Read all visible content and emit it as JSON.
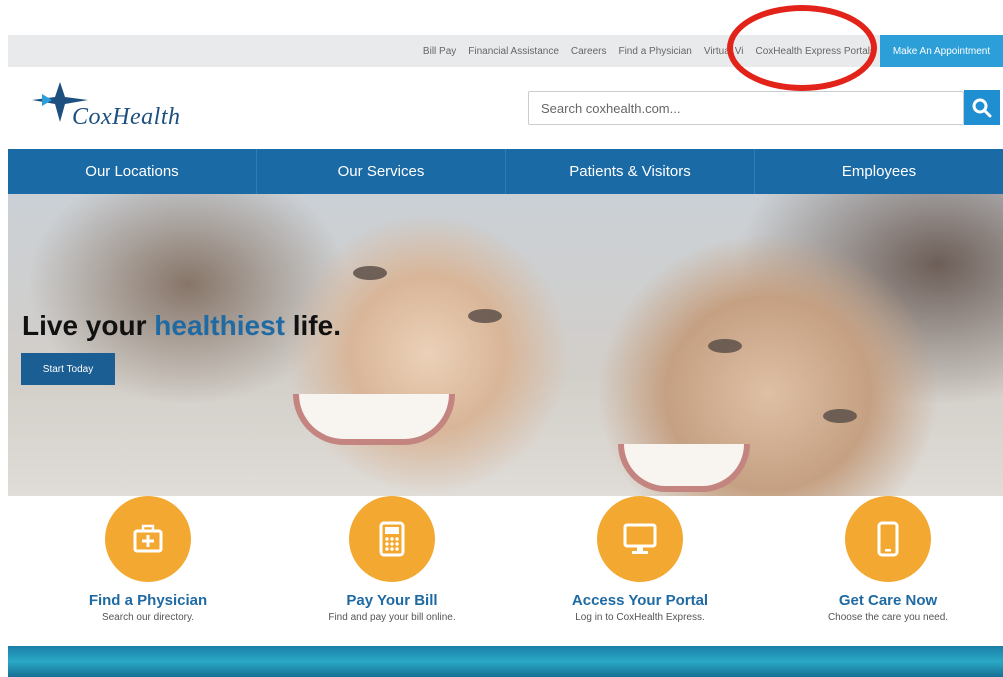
{
  "utility": {
    "links": [
      "Bill Pay",
      "Financial Assistance",
      "Careers",
      "Find a Physician",
      "Virtual Vi",
      "CoxHealth Express Portals"
    ],
    "appointment_label": "Make An Appointment",
    "accent_color": "#2c9fd9",
    "highlight_color": "#e2231a"
  },
  "header": {
    "logo_text": "CoxHealth",
    "search_placeholder": "Search coxhealth.com...",
    "search_icon": "search-icon"
  },
  "nav": {
    "items": [
      "Our Locations",
      "Our Services",
      "Patients & Visitors",
      "Employees"
    ],
    "color": "#1a6aa5"
  },
  "hero": {
    "headline_pre": "Live your ",
    "headline_accent": "healthiest",
    "headline_post": " life.",
    "cta_label": "Start Today"
  },
  "tiles": [
    {
      "icon": "medical-kit-icon",
      "title": "Find a Physician",
      "subtitle": "Search our directory."
    },
    {
      "icon": "calculator-icon",
      "title": "Pay Your Bill",
      "subtitle": "Find and pay your bill online."
    },
    {
      "icon": "monitor-icon",
      "title": "Access Your Portal",
      "subtitle": "Log in to CoxHealth Express."
    },
    {
      "icon": "phone-icon",
      "title": "Get Care Now",
      "subtitle": "Choose the care you need."
    }
  ],
  "tile_color": "#f3a931"
}
